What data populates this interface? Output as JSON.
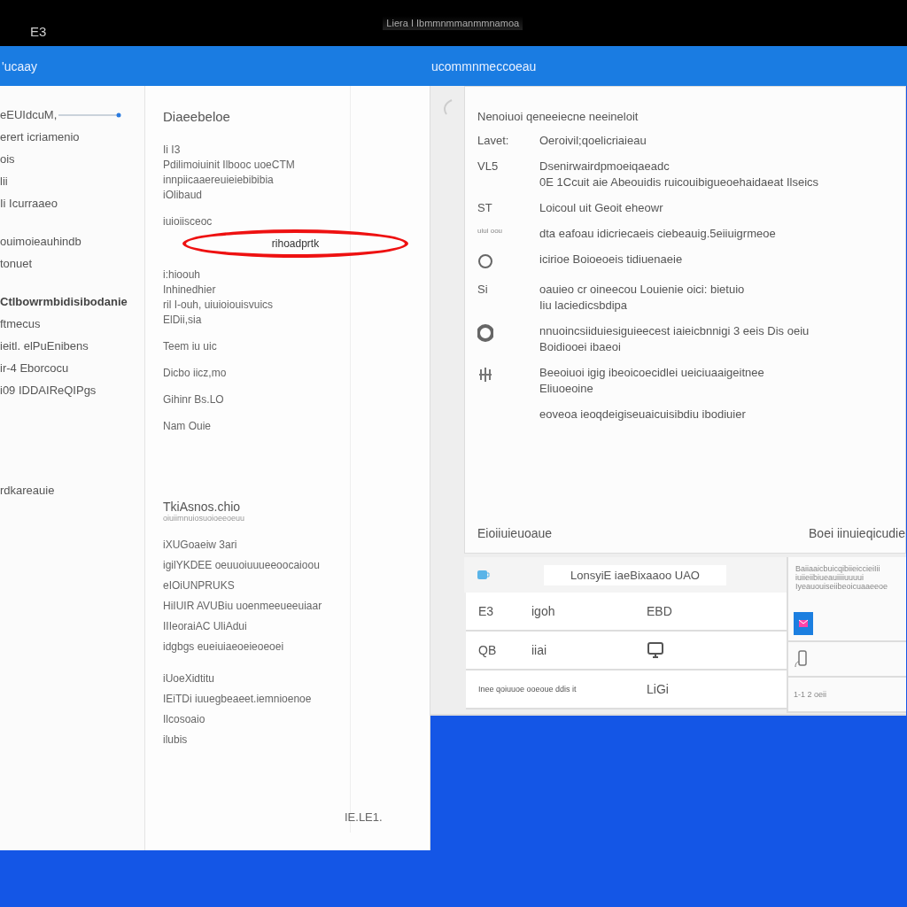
{
  "top_bar": {
    "left_text": "E3",
    "center_text": "Liera I Ibmmnmmanmmnamoa"
  },
  "header": {
    "app_title": "'ucaay",
    "window_title": "ucommnmeccoeau"
  },
  "left_nav": {
    "groups": [
      [
        {
          "label": "eEUIdcuM,",
          "heading": false
        },
        {
          "label": "erert icriamenio",
          "heading": false
        },
        {
          "label": "ois",
          "heading": false
        },
        {
          "label": "lii",
          "heading": false
        },
        {
          "label": "Ii Icurraaeo",
          "heading": false
        }
      ],
      [
        {
          "label": "ouimoieauhindb",
          "heading": false
        },
        {
          "label": "tonuet",
          "heading": false
        }
      ],
      [
        {
          "label": "Ctlbowrmbidisibodanie",
          "heading": true
        },
        {
          "label": "ftmecus",
          "heading": false
        },
        {
          "label": "ieitl. elPuEnibens",
          "heading": false
        },
        {
          "label": "ir-4 Eborcocu",
          "heading": false
        },
        {
          "label": "i09 IDDAIReQIPgs",
          "heading": false
        }
      ],
      [
        {
          "label": "rdkareauie",
          "heading": false
        }
      ]
    ]
  },
  "middle_panel": {
    "title": "Diaeebeloe",
    "groups": [
      [
        "Ii I3",
        "Pdilimoiuinit Ilbooc uoeCTM",
        "innpiicaaereuieiebibibia",
        "iOlibaud"
      ],
      [
        "iuioiisceoc"
      ],
      [
        "i:hioouh",
        "Inhinedhier",
        "ril I-ouh, uiuioiouisvuics",
        "ElDii,sia"
      ],
      [
        "Teem iu uic"
      ],
      [
        "Dicbo iicz,mo"
      ],
      [
        "Gihinr Bs.LO"
      ],
      [
        "Nam Ouie"
      ]
    ],
    "circled_label": "rihoadprtk",
    "section_title": "TkiAsnos.chio",
    "section_subtitle": "oiuiimnuiosuoioeeoeuu",
    "section_groups": [
      [
        "iXUGoaeiw 3ari",
        "igilYKDEE oeuuoiuuueeoocaioou",
        "eIOiUNPRUKS",
        "HiIUIR AVUBiu uoenmeeueeuiaar",
        "IIIeoraiAC UliAdui",
        "idgbgs eueiuiaeoeieoeoei"
      ],
      [
        "iUoeXidtitu",
        "IEiTDi iuuegbeaeet.iemnioenoe",
        "Ilcosoaio",
        "ilubis"
      ]
    ],
    "footer_text": "IE.LE1."
  },
  "detail_card": {
    "title": "Nenoiuoi qeneeiecne neeineloit",
    "rows": [
      {
        "kind": "label",
        "label": "Lavet:",
        "lines": [
          "Oeroivil;qoelicriaieau"
        ]
      },
      {
        "kind": "label",
        "label": "VL5",
        "lines": [
          "Dsenirwairdpmoeiqaeadc",
          "0E 1Ccuit aie Abeouidis ruicouibigueoehaidaeat Ilseics"
        ]
      },
      {
        "kind": "label",
        "label": "ST",
        "lines": [
          "Loicoul uit Geoit eheowr"
        ]
      },
      {
        "kind": "small",
        "label": "uiui oou",
        "lines": [
          "dta eafoau idicriecaeis ciebeauig.5eiiuigrmeoe"
        ]
      },
      {
        "kind": "ring",
        "lines": [
          "icirioe Boioeoeis tidiuenaeie"
        ]
      },
      {
        "kind": "label",
        "label": "Si",
        "lines": [
          "oauieo cr oineecou Louienie oici: bietuio",
          "Iiu laciedicsbdipa"
        ]
      },
      {
        "kind": "donut",
        "lines": [
          "nnuoincsiiduiesiguieecest iaieicbnnigi 3 eeis Dis oeiu",
          "Boidiooei ibaeoi"
        ]
      },
      {
        "kind": "gear",
        "lines": [
          "Beeoiuoi igig ibeoicoecidlei ueiciuaaigeitnee",
          "Eliuoeoine"
        ]
      },
      {
        "kind": "none",
        "lines": [
          "eoveoa ieoqdeigiseuaicuisibdiu ibodiuier"
        ]
      }
    ],
    "footer_left": "Eioiiuieuoaue",
    "footer_right": "Boei iinuieqicudie"
  },
  "table": {
    "toolbar_label": "LonsyiE iaeBixaaoo UAO",
    "side_header": [
      "BaiiaaicbuicqibiieiccieiIii",
      "iuiieiibiueauiiiiuuuui",
      "Iyeauouiseiibeoicuaaeeoe"
    ],
    "rows": [
      {
        "kind": "text",
        "cells": [
          "E3",
          "igoh",
          "EBD"
        ],
        "side": {
          "kind": "badge"
        }
      },
      {
        "kind": "icon",
        "cells": [
          "QB",
          "iiai"
        ],
        "side": {
          "kind": "phone"
        }
      },
      {
        "kind": "wide",
        "cells": [
          "Inee qoiuuoe ooeoue ddis it",
          "",
          "LiGi"
        ],
        "side": {
          "kind": "text",
          "text": "1-1 2 oeii"
        }
      }
    ]
  }
}
